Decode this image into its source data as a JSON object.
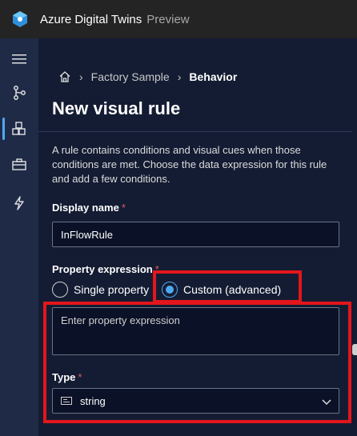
{
  "app": {
    "title": "Azure Digital Twins",
    "subtitle": "Preview",
    "brand_color": "#4fa8f0"
  },
  "rail": {
    "items": [
      {
        "name": "menu-icon"
      },
      {
        "name": "graph-icon"
      },
      {
        "name": "cubes-icon",
        "active": true
      },
      {
        "name": "toolbox-icon"
      },
      {
        "name": "lightning-icon"
      }
    ]
  },
  "breadcrumb": {
    "items": [
      "Factory Sample",
      "Behavior"
    ],
    "home_icon": "home-icon"
  },
  "page": {
    "title": "New visual rule",
    "description": "A rule contains conditions and visual cues when those conditions are met. Choose the data expression for this rule and add a few conditions."
  },
  "form": {
    "display_name": {
      "label": "Display name",
      "required_mark": "*",
      "value": "InFlowRule"
    },
    "property_expression": {
      "label": "Property expression",
      "required_mark": "*",
      "options": [
        "Single property",
        "Custom (advanced)"
      ],
      "selected": "Custom (advanced)",
      "placeholder": "Enter property expression"
    },
    "type": {
      "label": "Type",
      "required_mark": "*",
      "value": "string",
      "icon": "abc-icon"
    }
  },
  "colors": {
    "highlight": "#e3161c",
    "panel_bg": "#141c33",
    "topbar_bg": "#252424"
  }
}
